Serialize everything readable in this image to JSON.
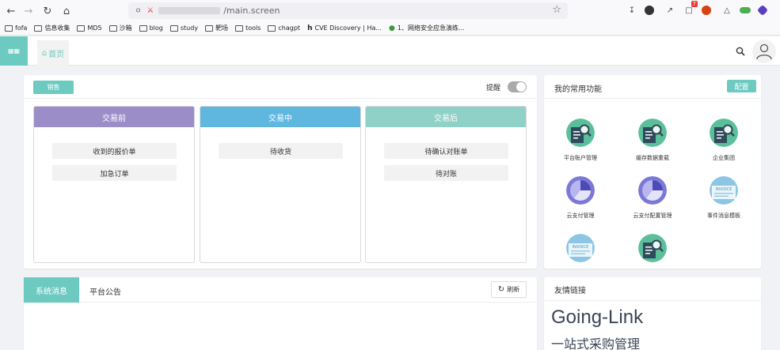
{
  "browser": {
    "address_suffix": "/main.screen",
    "ext_badge": "7"
  },
  "bookmarks": [
    {
      "label": "fofa",
      "icon": "folder-icon"
    },
    {
      "label": "信息收集",
      "icon": "folder-icon"
    },
    {
      "label": "MD5",
      "icon": "folder-icon"
    },
    {
      "label": "沙箱",
      "icon": "folder-icon"
    },
    {
      "label": "blog",
      "icon": "folder-icon"
    },
    {
      "label": "study",
      "icon": "folder-icon"
    },
    {
      "label": "靶场",
      "icon": "folder-icon"
    },
    {
      "label": "tools",
      "icon": "folder-icon"
    },
    {
      "label": "chagpt",
      "icon": "folder-icon"
    },
    {
      "label": "CVE Discovery | Ha...",
      "icon": "h-icon"
    },
    {
      "label": "1、网络安全应急演练...",
      "icon": "leaf-icon"
    }
  ],
  "header": {
    "home_tab": "首页"
  },
  "tasks": {
    "sales_button": "销售",
    "remind_label": "提醒",
    "columns": [
      {
        "title": "交易前",
        "color": "#9b8ec8",
        "items": [
          "收到的报价单",
          "加急订单"
        ]
      },
      {
        "title": "交易中",
        "color": "#5fb7e0",
        "items": [
          "待收货"
        ]
      },
      {
        "title": "交易后",
        "color": "#8fd1c6",
        "items": [
          "待确认对账单",
          "待对账"
        ]
      }
    ]
  },
  "functions": {
    "title": "我的常用功能",
    "config_button": "配置",
    "items": [
      {
        "label": "平台账户管理",
        "icon": "document-search-icon"
      },
      {
        "label": "缓存数据重载",
        "icon": "document-search-icon"
      },
      {
        "label": "企业集团",
        "icon": "document-search-icon"
      },
      {
        "label": "云支付管理",
        "icon": "pie-chart-icon"
      },
      {
        "label": "云支付配置管理",
        "icon": "pie-chart-icon"
      },
      {
        "label": "事件消息模板",
        "icon": "invoice-icon"
      },
      {
        "label": "",
        "icon": "invoice-icon"
      },
      {
        "label": "",
        "icon": "document-search-icon"
      }
    ],
    "invoice_text": "INVOICE"
  },
  "messages": {
    "tab_system": "系统消息",
    "tab_platform": "平台公告",
    "refresh_button": "刷新"
  },
  "links": {
    "title": "友情链接",
    "brand": "Going-Link",
    "tagline": "一站式采购管理"
  },
  "colors": {
    "accent": "#6ccac0",
    "green_icon": "#5bbf9a",
    "purple_icon": "#7b78d8",
    "invoice_icon": "#8cc6e4"
  }
}
